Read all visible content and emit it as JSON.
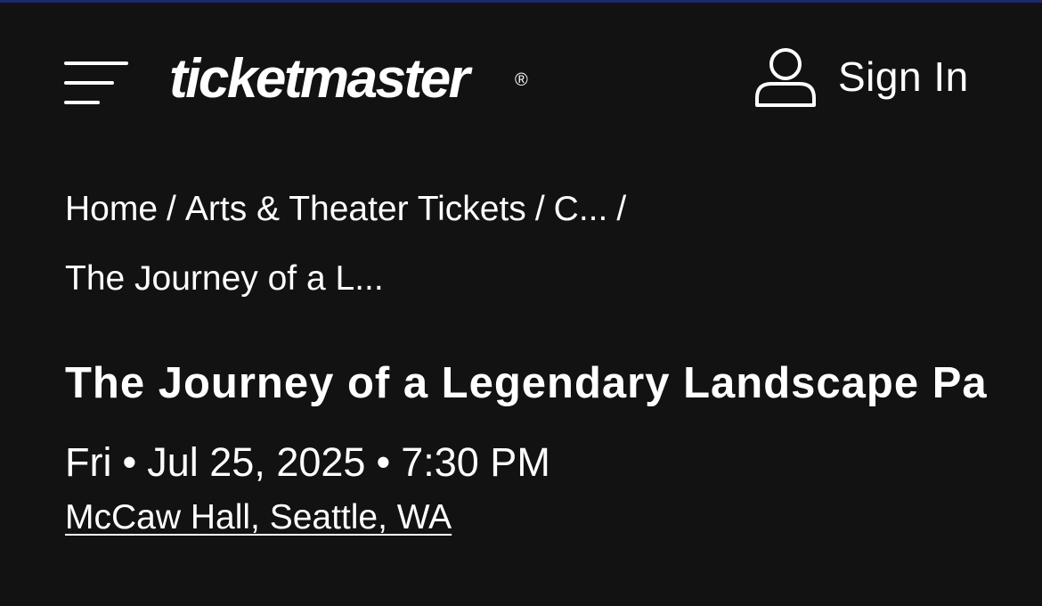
{
  "header": {
    "menu_icon": "hamburger-menu-icon",
    "logo_text": "ticketmaster",
    "logo_reg": "®",
    "signin_icon": "user-icon",
    "signin_label": "Sign In"
  },
  "breadcrumb": {
    "home": "Home",
    "arts": "Arts & Theater Tickets",
    "category": "C...",
    "separator": "/",
    "current": "The Journey of a L..."
  },
  "event": {
    "title": "The Journey of a Legendary Landscape Pa",
    "day": "Fri",
    "date": "Jul 25, 2025",
    "time": "7:30 PM",
    "dot": "•",
    "venue": "McCaw Hall, Seattle, WA"
  },
  "colors": {
    "background": "#121212",
    "text": "#ffffff",
    "top_accent": "#1a2a6c"
  }
}
